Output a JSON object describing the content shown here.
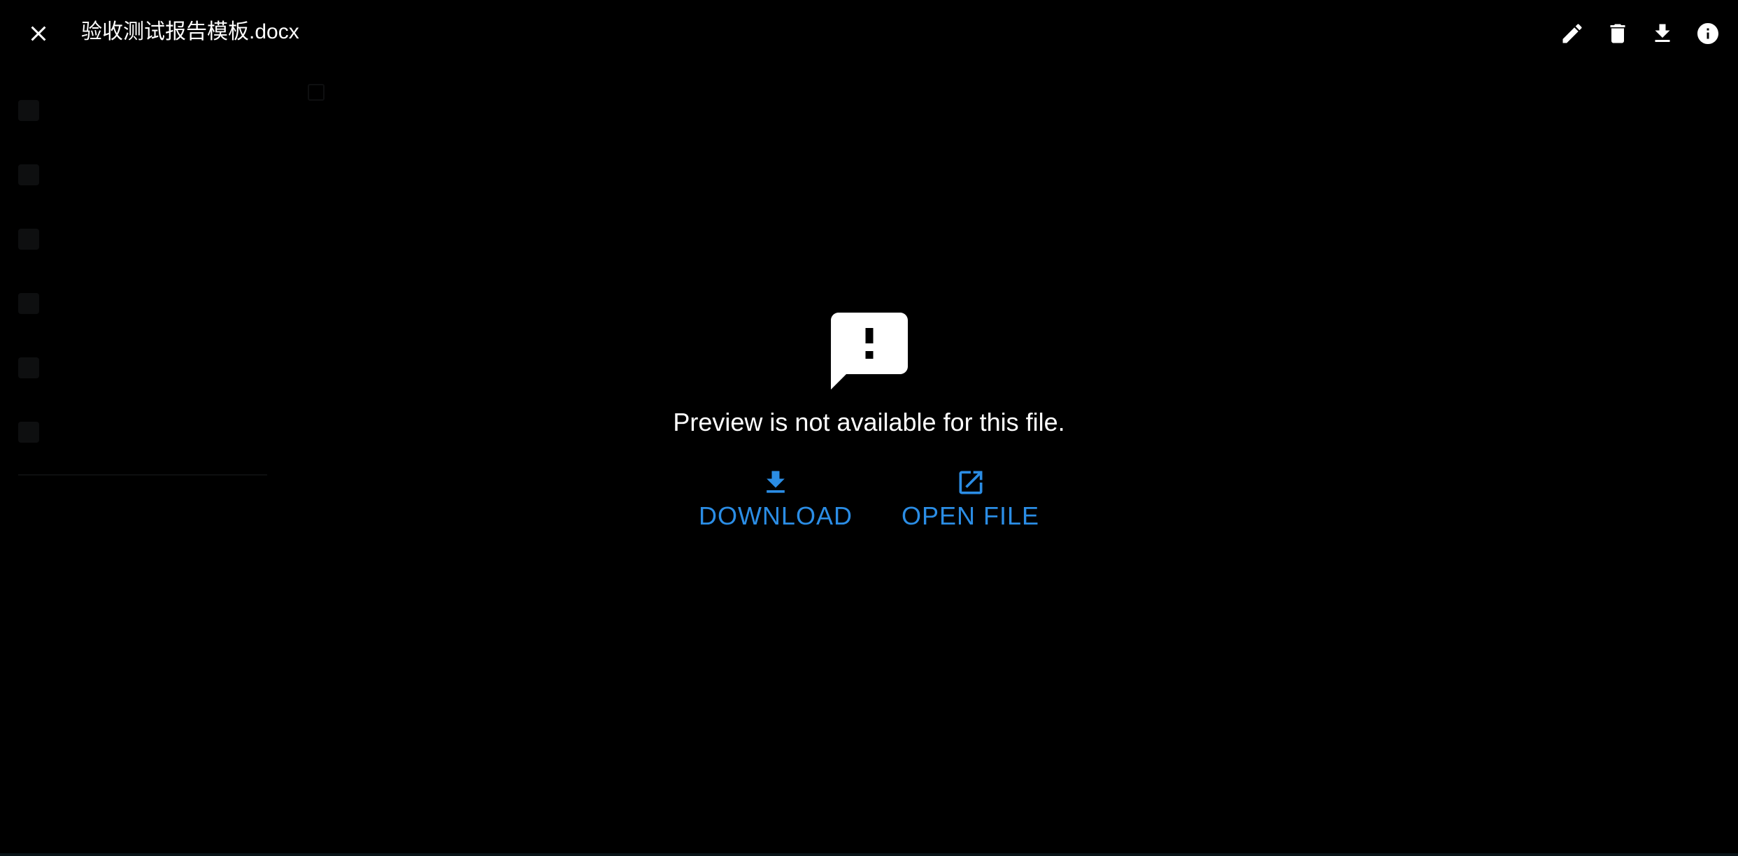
{
  "viewer": {
    "title": "验收测试报告模板.docx",
    "toolbar": {
      "close_icon": "close-icon",
      "edit_icon": "pencil-icon",
      "delete_icon": "trash-icon",
      "download_icon": "download-icon",
      "info_icon": "info-icon"
    },
    "message": "Preview is not available for this file.",
    "actions": {
      "download_label": "DOWNLOAD",
      "open_label": "OPEN FILE"
    }
  },
  "colors": {
    "background": "#000000",
    "text": "#ffffff",
    "accent": "#2b8de5"
  }
}
